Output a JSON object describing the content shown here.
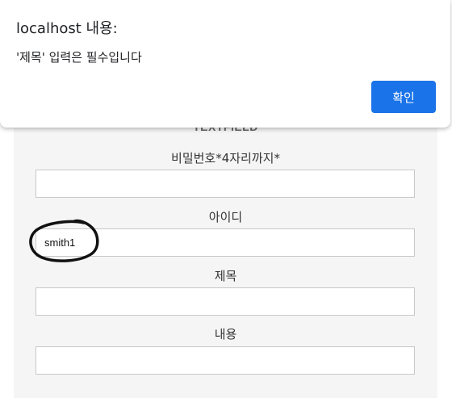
{
  "dialog": {
    "title": "localhost 내용:",
    "message": "'제목' 입력은 필수입니다",
    "ok_label": "확인",
    "ok_color": "#1a73e8"
  },
  "form": {
    "section_title": "TEXTFIELD",
    "fields": [
      {
        "label": "비밀번호*4자리까지*",
        "value": ""
      },
      {
        "label": "아이디",
        "value": "smith1"
      },
      {
        "label": "제목",
        "value": ""
      },
      {
        "label": "내용",
        "value": ""
      }
    ]
  }
}
